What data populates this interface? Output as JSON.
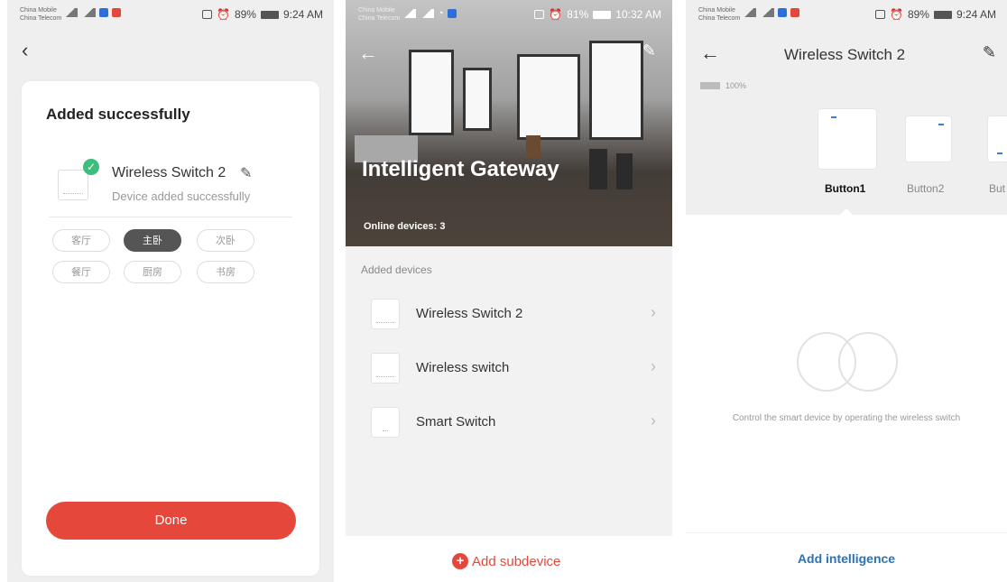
{
  "colors": {
    "accent_red": "#e5483b",
    "success_green": "#3dbe7d",
    "link_blue": "#2a73b8"
  },
  "panel1": {
    "status": {
      "carrier1": "China Mobile",
      "carrier2": "China Telecom",
      "battery": "89%",
      "time": "9:24 AM"
    },
    "heading": "Added successfully",
    "device_name": "Wireless Switch 2",
    "device_status": "Device added successfully",
    "rooms": [
      "客厅",
      "主卧",
      "次卧",
      "餐厅",
      "厨房",
      "书房"
    ],
    "selected_room": "主卧",
    "done_label": "Done"
  },
  "panel2": {
    "status": {
      "carrier1": "China Mobile",
      "carrier2": "China Telecom",
      "battery": "81%",
      "time": "10:32 AM"
    },
    "title": "Intelligent Gateway",
    "online": "Online devices: 3",
    "section_label": "Added devices",
    "devices": [
      {
        "name": "Wireless Switch 2",
        "icon": "three-gang-switch-icon"
      },
      {
        "name": "Wireless switch",
        "icon": "three-gang-switch-icon"
      },
      {
        "name": "Smart Switch",
        "icon": "single-switch-icon"
      }
    ],
    "add_label": "Add subdevice"
  },
  "panel3": {
    "status": {
      "carrier1": "China Mobile",
      "carrier2": "China Telecom",
      "battery": "89%",
      "time": "9:24 AM"
    },
    "title": "Wireless Switch 2",
    "battery_level": "100%",
    "buttons": [
      "Button1",
      "Button2",
      "But"
    ],
    "selected_button": "Button1",
    "hint": "Control the smart device by operating the wireless switch",
    "add_label": "Add intelligence"
  }
}
